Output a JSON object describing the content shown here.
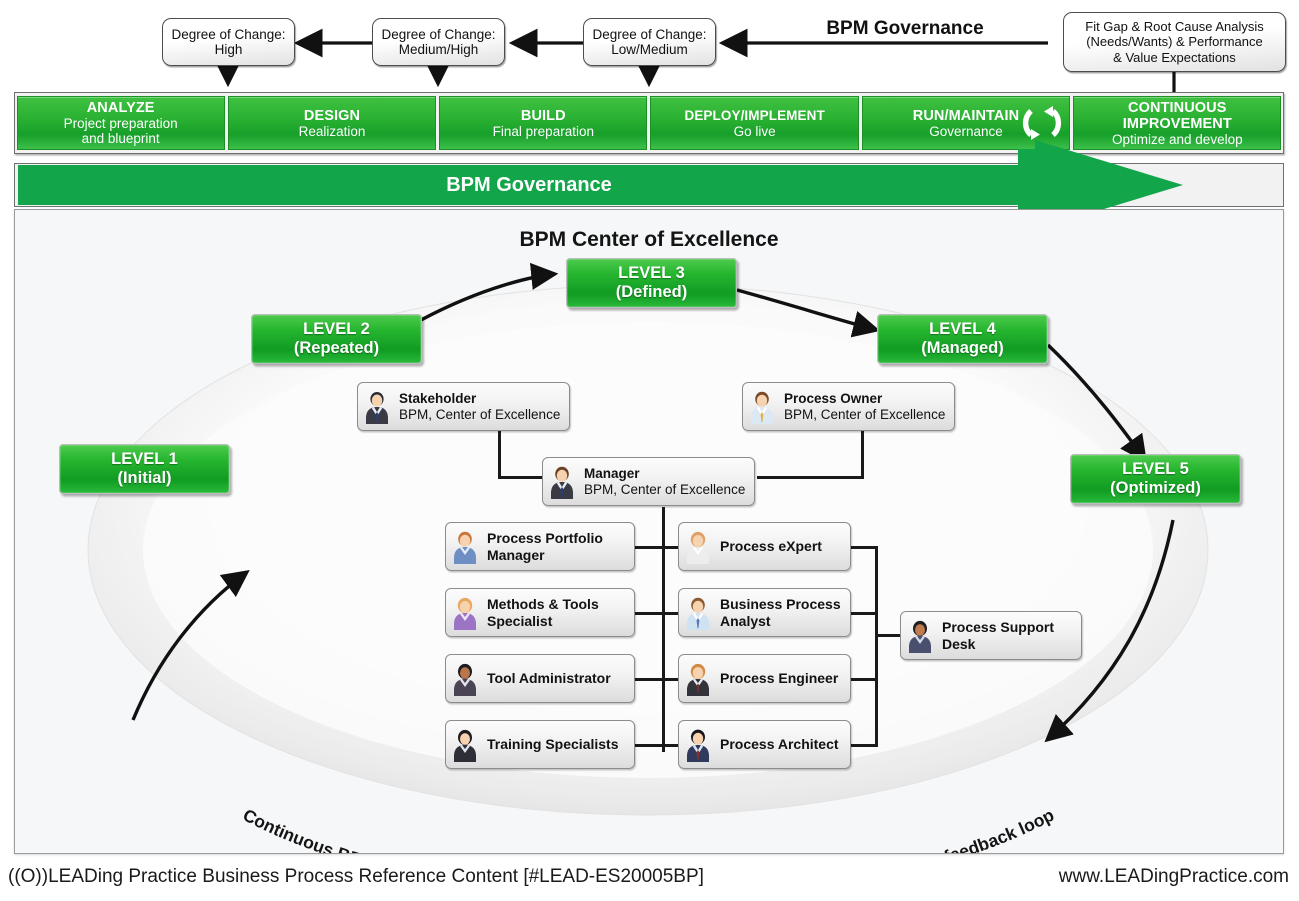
{
  "top": {
    "governance_arrow_label": "BPM Governance",
    "degree_boxes": [
      {
        "line1": "Degree of Change:",
        "line2": "High"
      },
      {
        "line1": "Degree of Change:",
        "line2": "Medium/High"
      },
      {
        "line1": "Degree of Change:",
        "line2": "Low/Medium"
      }
    ],
    "fit_gap": {
      "line1": "Fit Gap & Root Cause Analysis",
      "line2": "(Needs/Wants) & Performance",
      "line3": "& Value Expectations"
    }
  },
  "phases": [
    {
      "title": "ANALYZE",
      "sub": "Project preparation\nand blueprint"
    },
    {
      "title": "DESIGN",
      "sub": "Realization"
    },
    {
      "title": "BUILD",
      "sub": "Final preparation"
    },
    {
      "title": "DEPLOY/IMPLEMENT",
      "sub": "Go live"
    },
    {
      "title": "RUN/MAINTAIN",
      "sub": "Governance"
    },
    {
      "title": "CONTINUOUS\nIMPROVEMENT",
      "sub": "Optimize and develop"
    }
  ],
  "governance_banner": {
    "label": "BPM Governance"
  },
  "panel": {
    "title": "BPM Center of Excellence",
    "loop_caption": "Continuous BPM improvement, optimization and development through a collaborative feedback loop"
  },
  "levels": [
    {
      "num": "LEVEL 1",
      "state": "(Initial)"
    },
    {
      "num": "LEVEL 2",
      "state": "(Repeated)"
    },
    {
      "num": "LEVEL 3",
      "state": "(Defined)"
    },
    {
      "num": "LEVEL 4",
      "state": "(Managed)"
    },
    {
      "num": "LEVEL 5",
      "state": "(Optimized)"
    }
  ],
  "roles": {
    "stakeholder": {
      "name": "Stakeholder",
      "role": "BPM, Center of Excellence"
    },
    "process_owner": {
      "name": "Process Owner",
      "role": "BPM, Center of Excellence"
    },
    "manager": {
      "name": "Manager",
      "role": "BPM, Center of Excellence"
    },
    "left_column": [
      {
        "name": "Process Portfolio\nManager"
      },
      {
        "name": "Methods & Tools\nSpecialist"
      },
      {
        "name": "Tool Administrator"
      },
      {
        "name": "Training Specialists"
      }
    ],
    "right_column": [
      {
        "name": "Process eXpert"
      },
      {
        "name": "Business Process\nAnalyst"
      },
      {
        "name": "Process Engineer"
      },
      {
        "name": "Process Architect"
      }
    ],
    "support_desk": {
      "name": "Process Support\nDesk"
    }
  },
  "footer": {
    "left": "((O))LEADing Practice Business Process Reference Content [#LEAD-ES20005BP]",
    "right": "www.LEADingPractice.com"
  },
  "colors": {
    "phase_green": "#27b22f",
    "banner_green": "#13a54a",
    "level_green": "#1ea52b",
    "panel_bg": "#f6f7f8",
    "line": "#1a1a1a"
  }
}
